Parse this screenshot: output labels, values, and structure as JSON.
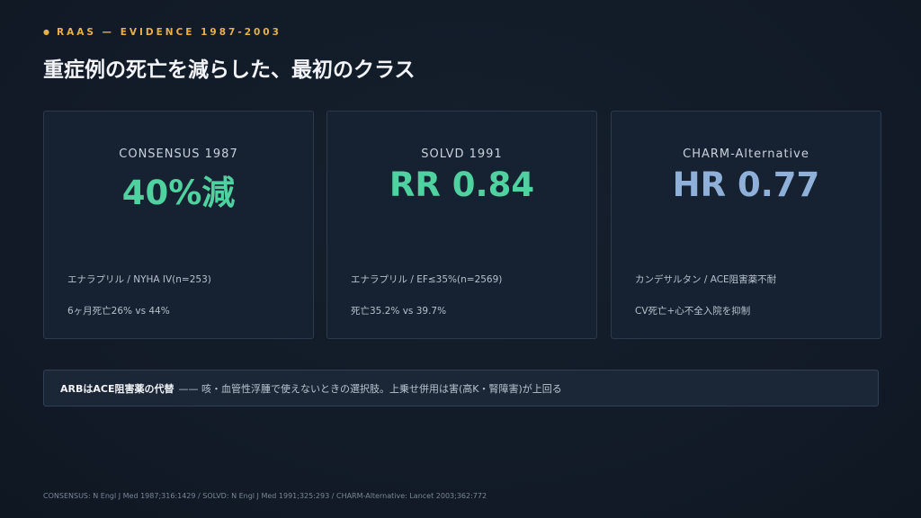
{
  "eyebrow": {
    "dot": "●",
    "text": "RAAS — EVIDENCE 1987-2003"
  },
  "title": "重症例の死亡を減らした、最初のクラス",
  "colors": {
    "accent_orange": "#e8b04a",
    "metric_green": "#4fd1a0",
    "metric_blue": "#8fb0d8"
  },
  "cards": [
    {
      "name": "CONSENSUS 1987",
      "metric": "40%減",
      "metric_color": "#4fd1a0",
      "line1": "エナラプリル / NYHA IV(n=253)",
      "line2": "6ヶ月死亡26% vs 44%"
    },
    {
      "name": "SOLVD 1991",
      "metric": "RR 0.84",
      "metric_color": "#4fd1a0",
      "line1": "エナラプリル / EF≤35%(n=2569)",
      "line2": "死亡35.2% vs 39.7%"
    },
    {
      "name": "CHARM-Alternative",
      "metric": "HR 0.77",
      "metric_color": "#8fb0d8",
      "line1": "カンデサルタン / ACE阻害薬不耐",
      "line2": "CV死亡+心不全入院を抑制"
    }
  ],
  "note": {
    "bold": "ARBはACE阻害薬の代替",
    "text": "—— 咳・血管性浮腫で使えないときの選択肢。上乗せ併用は害(高K・腎障害)が上回る"
  },
  "footer": "CONSENSUS: N Engl J Med 1987;316:1429 / SOLVD: N Engl J Med 1991;325:293 / CHARM-Alternative: Lancet 2003;362:772"
}
